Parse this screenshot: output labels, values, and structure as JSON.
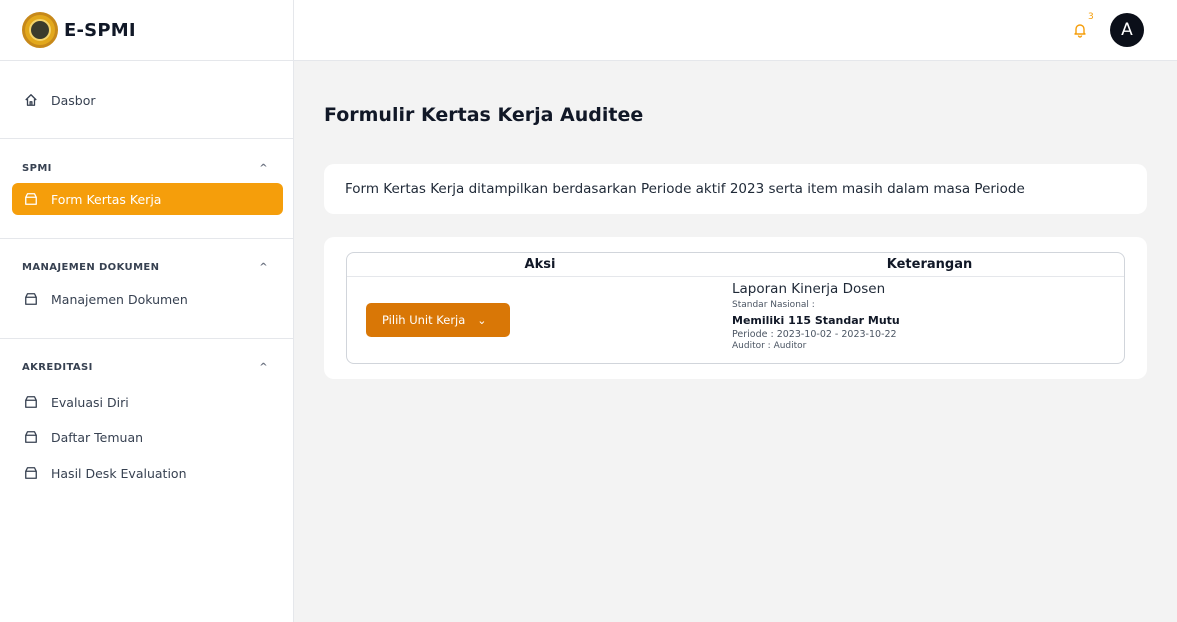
{
  "brand": {
    "name": "E-SPMI"
  },
  "sidebar": {
    "dashboard": "Dasbor",
    "sections": [
      {
        "title": "SPMI",
        "items": [
          {
            "label": "Form Kertas Kerja",
            "active": true
          }
        ]
      },
      {
        "title": "MANAJEMEN DOKUMEN",
        "items": [
          {
            "label": "Manajemen Dokumen"
          }
        ]
      },
      {
        "title": "AKREDITASI",
        "items": [
          {
            "label": "Evaluasi Diri"
          },
          {
            "label": "Daftar Temuan"
          },
          {
            "label": "Hasil Desk Evaluation"
          }
        ]
      }
    ]
  },
  "topbar": {
    "notification_count": "3",
    "avatar_initial": "A"
  },
  "main": {
    "title": "Formulir Kertas Kerja Auditee",
    "info": "Form Kertas Kerja ditampilkan berdasarkan Periode aktif 2023 serta item masih dalam masa Periode",
    "table": {
      "headers": [
        "Aksi",
        "Keterangan"
      ],
      "rows": [
        {
          "button_label": "Pilih Unit Kerja",
          "title": "Laporan Kinerja Dosen",
          "standard_label": "Standar Nasional :",
          "standard_value": "Memiliki 115 Standar Mutu",
          "period": "Periode : 2023-10-02 - 2023-10-22",
          "auditor": "Auditor : Auditor"
        }
      ]
    }
  },
  "colors": {
    "accent": "#f59e0b",
    "button": "#d97706",
    "avatar_bg": "#0b0f19"
  }
}
